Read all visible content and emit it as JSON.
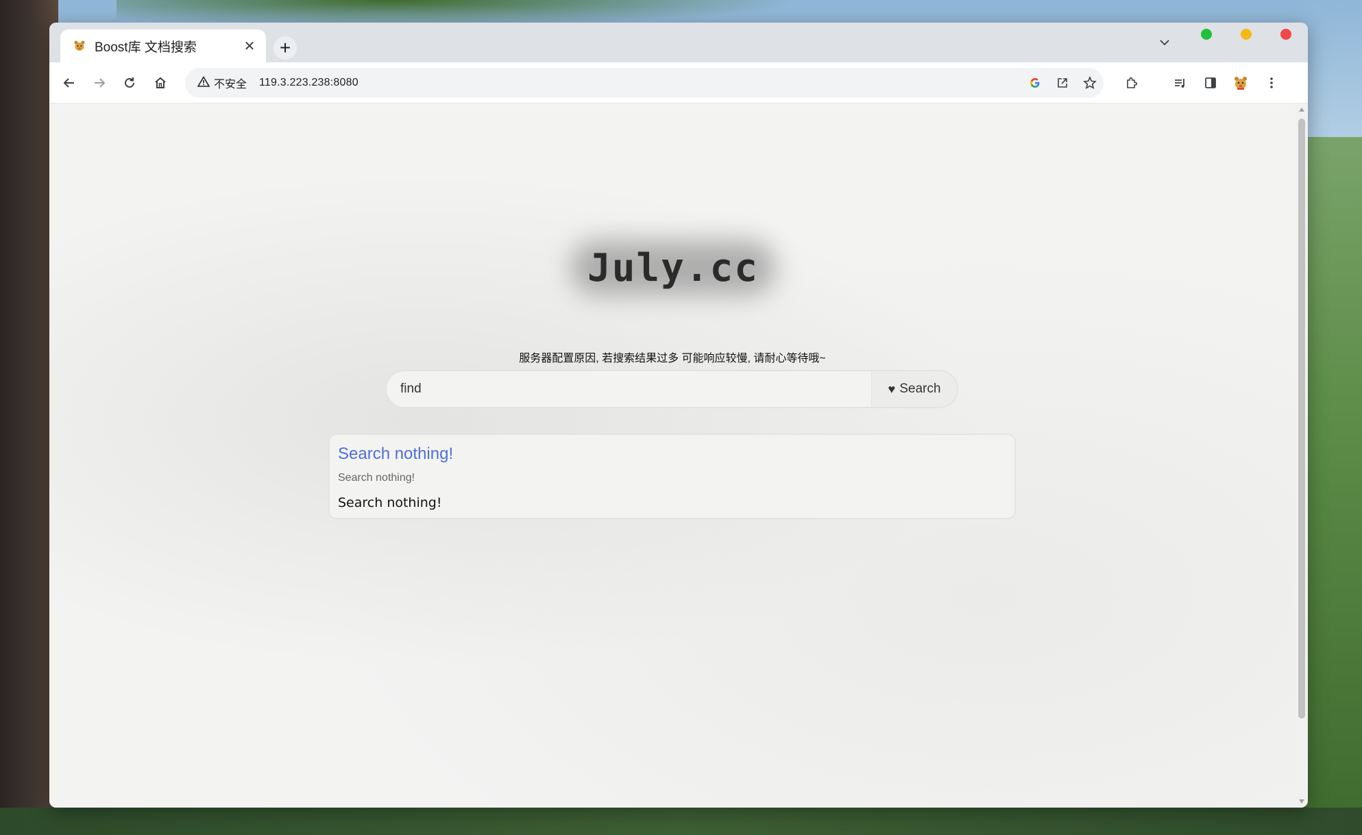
{
  "browser": {
    "tab": {
      "title": "Boost库 文档搜索",
      "close_glyph": "✕",
      "favicon": "bear-favicon-icon"
    },
    "new_tab_glyph": "+",
    "window_controls": {
      "green": "#1fc03a",
      "yellow": "#f5b915",
      "red": "#f04848"
    },
    "address_bar": {
      "security_label": "不安全",
      "url": "119.3.223.238:8080"
    }
  },
  "page": {
    "logo": "July.cc",
    "notice": "服务器配置原因, 若搜索结果过多 可能响应较慢, 请耐心等待哦~",
    "search": {
      "value": "find",
      "button_glyph": "♥",
      "button_label": "Search"
    },
    "results": [
      {
        "title": "Search nothing!",
        "url": "Search nothing!",
        "desc": "Search nothing!"
      }
    ],
    "colors": {
      "link": "#4f6fd8",
      "background": "#f3f3f2"
    }
  }
}
